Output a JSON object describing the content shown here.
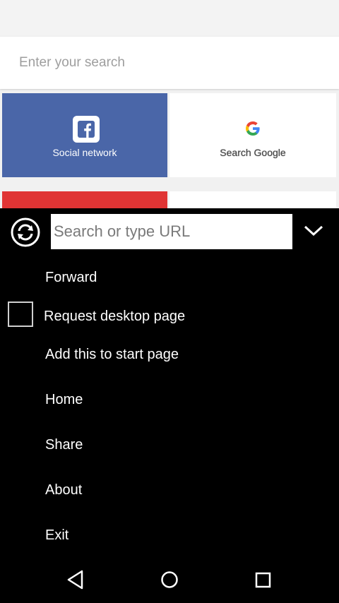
{
  "search": {
    "placeholder": "Enter your search"
  },
  "tiles": [
    {
      "label": "Social network",
      "color": "#4a66a8",
      "icon": "facebook-icon"
    },
    {
      "label": "Search Google",
      "color": "#ffffff",
      "icon": "google-icon"
    }
  ],
  "menu": {
    "url_placeholder": "Search or type URL",
    "items": {
      "forward": "Forward",
      "request_desktop": "Request desktop page",
      "add_start": "Add this to start page",
      "home": "Home",
      "share": "Share",
      "about": "About",
      "exit": "Exit"
    },
    "request_desktop_checked": false
  },
  "navbar": {
    "icons": [
      "back-icon",
      "home-circle-icon",
      "recents-square-icon"
    ]
  }
}
